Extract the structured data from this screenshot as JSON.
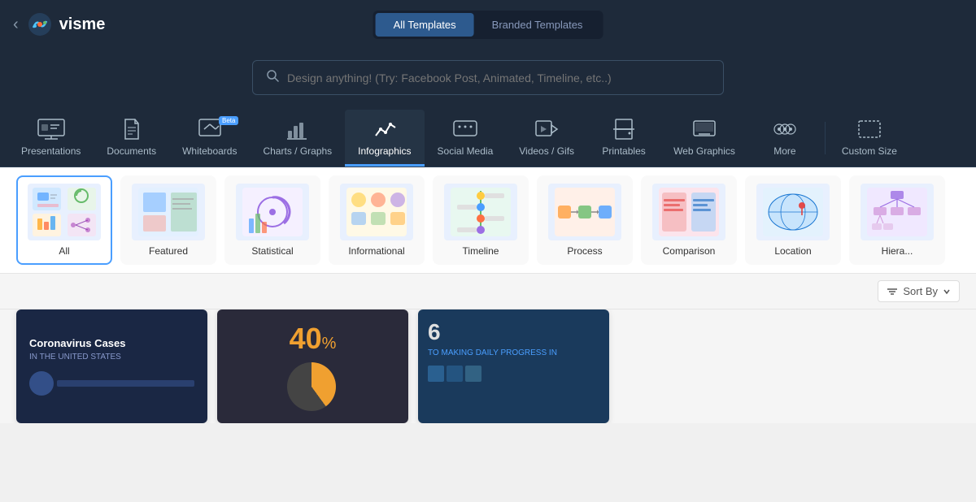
{
  "topbar": {
    "logo_text": "visme",
    "tabs": [
      {
        "id": "all",
        "label": "All Templates",
        "active": true
      },
      {
        "id": "branded",
        "label": "Branded Templates",
        "active": false
      }
    ]
  },
  "search": {
    "placeholder": "Design anything! (Try: Facebook Post, Animated, Timeline, etc..)"
  },
  "categories": [
    {
      "id": "presentations",
      "label": "Presentations",
      "icon": "slides",
      "active": false,
      "beta": false
    },
    {
      "id": "documents",
      "label": "Documents",
      "icon": "doc",
      "active": false,
      "beta": false
    },
    {
      "id": "whiteboards",
      "label": "Whiteboards",
      "icon": "whiteboard",
      "active": false,
      "beta": true
    },
    {
      "id": "charts",
      "label": "Charts / Graphs",
      "icon": "chart",
      "active": false,
      "beta": false
    },
    {
      "id": "infographics",
      "label": "Infographics",
      "icon": "infographic",
      "active": true,
      "beta": false
    },
    {
      "id": "social",
      "label": "Social Media",
      "icon": "social",
      "active": false,
      "beta": false
    },
    {
      "id": "videos",
      "label": "Videos / Gifs",
      "icon": "video",
      "active": false,
      "beta": false
    },
    {
      "id": "printables",
      "label": "Printables",
      "icon": "print",
      "active": false,
      "beta": false
    },
    {
      "id": "webgraphics",
      "label": "Web Graphics",
      "icon": "web",
      "active": false,
      "beta": false
    },
    {
      "id": "more",
      "label": "More",
      "icon": "more",
      "active": false,
      "beta": false
    },
    {
      "id": "custom",
      "label": "Custom Size",
      "icon": "custom",
      "active": false,
      "beta": false
    }
  ],
  "sub_filters": [
    {
      "id": "all",
      "label": "All",
      "active": true
    },
    {
      "id": "featured",
      "label": "Featured",
      "active": false
    },
    {
      "id": "statistical",
      "label": "Statistical",
      "active": false
    },
    {
      "id": "informational",
      "label": "Informational",
      "active": false
    },
    {
      "id": "timeline",
      "label": "Timeline",
      "active": false
    },
    {
      "id": "process",
      "label": "Process",
      "active": false
    },
    {
      "id": "comparison",
      "label": "Comparison",
      "active": false
    },
    {
      "id": "location",
      "label": "Location",
      "active": false
    },
    {
      "id": "hierarchy",
      "label": "Hiera...",
      "active": false
    }
  ],
  "sort": {
    "label": "Sort By",
    "icon": "sort-icon"
  },
  "preview_cards": [
    {
      "id": "covid",
      "type": "covid",
      "title": "Coronavirus Cases",
      "subtitle": "IN THE UNITED STATES"
    },
    {
      "id": "forty",
      "type": "40pct",
      "number": "40%",
      "desc": ""
    },
    {
      "id": "six",
      "type": "number6",
      "number": "6",
      "text": "TO MAKING DAILY PROGRESS IN"
    }
  ]
}
